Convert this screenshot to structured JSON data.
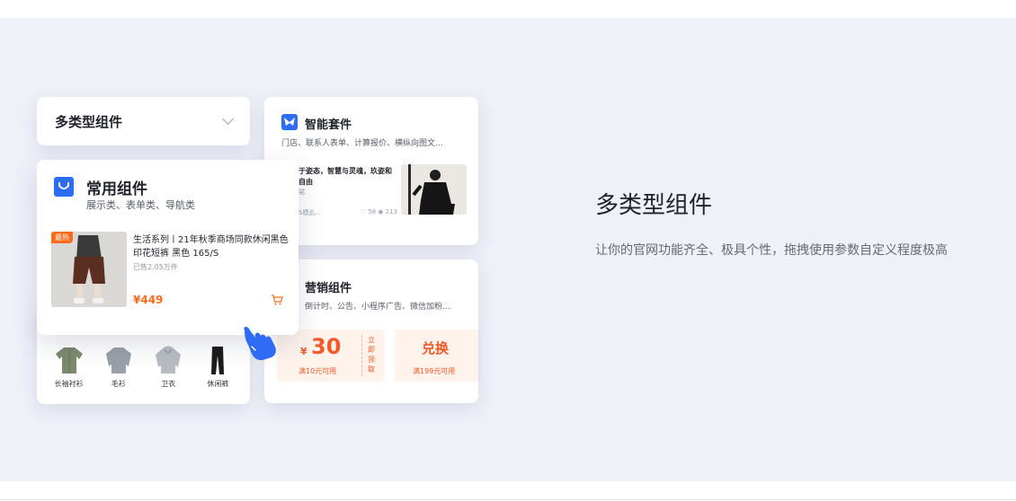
{
  "dropdown": {
    "label": "多类型组件"
  },
  "common_card": {
    "title": "常用组件",
    "subtitle": "展示类、表单类、导航类",
    "product": {
      "badge": "最热",
      "title": "生活系列丨21年秋季商场同款休闲黑色印花短裤 黑色 165/S",
      "sold": "已售2.05万件",
      "price": "¥449"
    },
    "categories": [
      {
        "label": "长袖衬衫",
        "icon": "shirt-icon",
        "color": "#7d8a6e"
      },
      {
        "label": "毛衫",
        "icon": "sweater-icon",
        "color": "#9aa0a8"
      },
      {
        "label": "卫衣",
        "icon": "hoodie-icon",
        "color": "#b8bcc2"
      },
      {
        "label": "休闲裤",
        "icon": "pants-icon",
        "color": "#1c1c1c"
      }
    ]
  },
  "smart_card": {
    "title": "智能套件",
    "subtitle": "门店、联系人表单、计算报价、横纵向图文...",
    "article_title": "于姿态，智慧与灵魂，玖姿和自由",
    "article_tag": "裙",
    "author": "S模乩...",
    "likes": "58",
    "views": "213"
  },
  "marketing_card": {
    "title": "营销组件",
    "subtitle": "倒计时、公告、小程序广告、微信加粉...",
    "coupon": {
      "currency": "¥",
      "value": "30",
      "condition": "满10元可用",
      "action": "立即领取"
    },
    "exchange": {
      "label": "兑换",
      "condition": "满199元可用"
    }
  },
  "main": {
    "heading": "多类型组件",
    "description": "让你的官网功能齐全、极具个性，拖拽使用参数自定义程度极高"
  },
  "colors": {
    "brand_blue": "#2e6cf6",
    "accent_orange": "#ff6b1a",
    "coupon_bg": "#fff3ec",
    "band_bg": "#eff1f9"
  }
}
